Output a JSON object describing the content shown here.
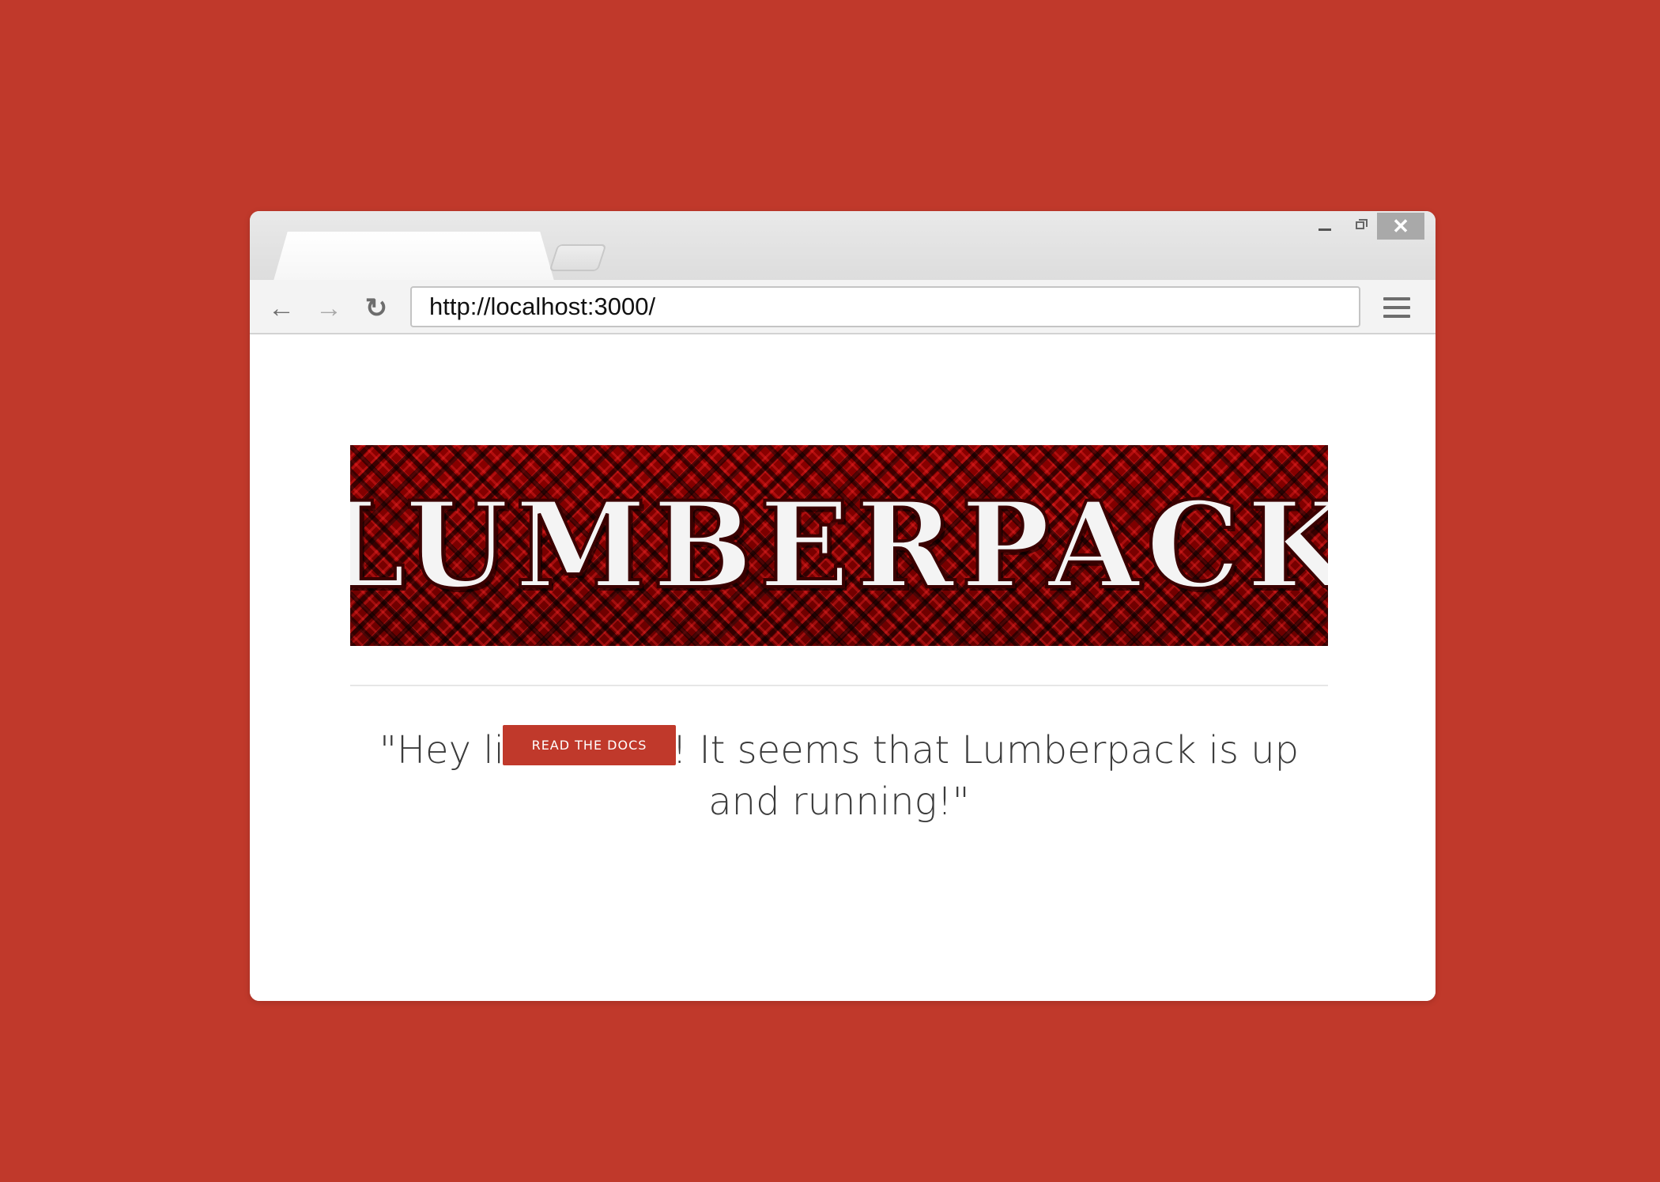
{
  "background_color": "#c0392b",
  "browser": {
    "address_url": "http://localhost:3000/",
    "window_controls": {
      "minimize_icon": "minimize-icon",
      "maximize_icon": "restore-icon",
      "close_glyph": "✕"
    },
    "nav": {
      "back_glyph": "←",
      "forward_glyph": "→",
      "reload_glyph": "↻"
    }
  },
  "page": {
    "banner_text": "LUMBERPACK",
    "headline": "\"Hey lil' lumber! It seems that Lumberpack is up and running!\"",
    "button_label": "READ THE DOCS",
    "button_color": "#c0392b"
  }
}
